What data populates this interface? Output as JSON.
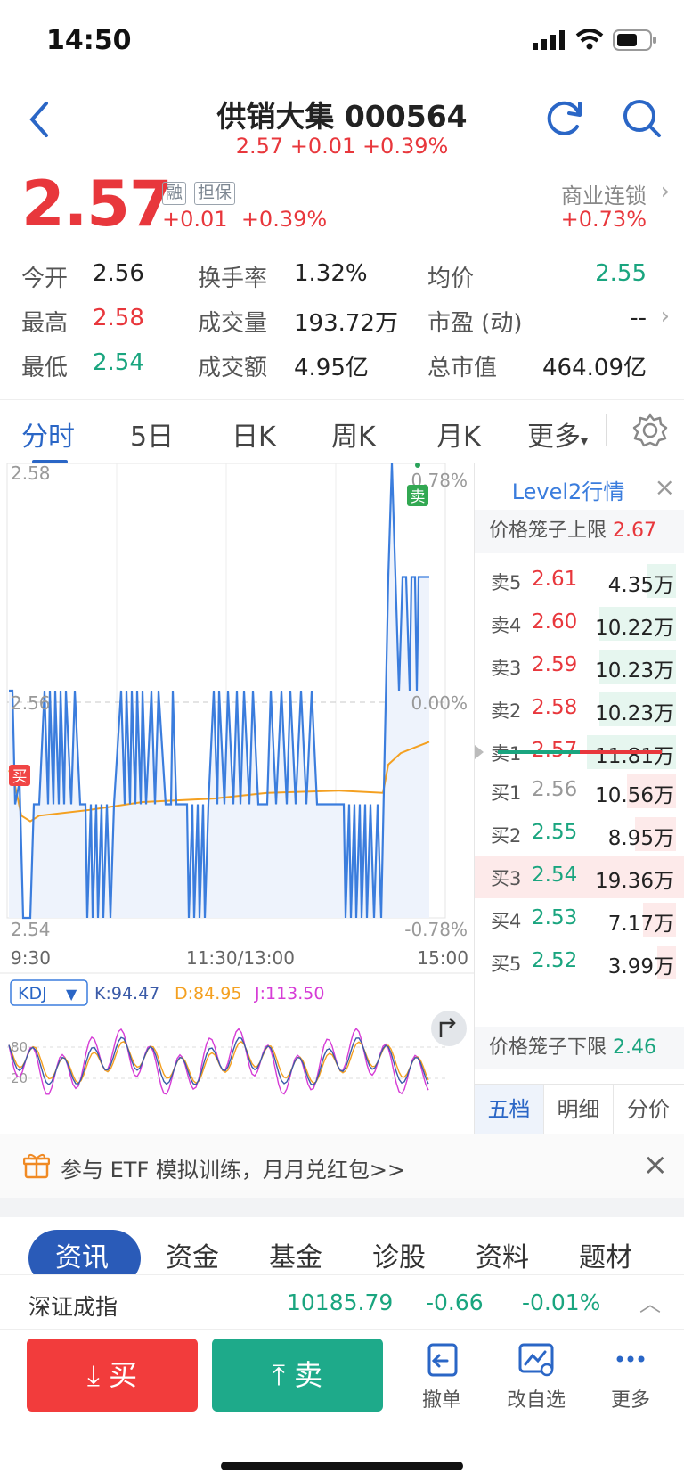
{
  "status_bar": {
    "time": "14:50"
  },
  "header": {
    "title": "供销大集 000564",
    "subtitle": "2.57 +0.01 +0.39%"
  },
  "quote": {
    "price": "2.57",
    "tag_margin": "融",
    "tag_guarantee": "担保",
    "change": "+0.01",
    "change_pct": "+0.39%",
    "industry": "商业连锁",
    "industry_pct": "+0.73%"
  },
  "stats": [
    {
      "label": "今开",
      "value": "2.56",
      "color": "#222222"
    },
    {
      "label": "换手率",
      "value": "1.32%",
      "color": "#222222"
    },
    {
      "label": "均价",
      "value": "2.55",
      "color": "#1aa57f"
    },
    {
      "label": "最高",
      "value": "2.58",
      "color": "#e8373c"
    },
    {
      "label": "成交量",
      "value": "193.72万",
      "color": "#222222"
    },
    {
      "label": "市盈 (动)",
      "value": "--",
      "color": "#222222"
    },
    {
      "label": "最低",
      "value": "2.54",
      "color": "#1aa57f"
    },
    {
      "label": "成交额",
      "value": "4.95亿",
      "color": "#222222"
    },
    {
      "label": "总市值",
      "value": "464.09亿",
      "color": "#222222"
    }
  ],
  "tabs": [
    "分时",
    "5日",
    "日K",
    "周K",
    "月K",
    "更多"
  ],
  "chart": {
    "price_high": "2.58",
    "price_mid": "2.56",
    "price_low": "2.54",
    "pct_high": "0.78%",
    "pct_mid": "0.00%",
    "pct_low": "-0.78%",
    "time_start": "9:30",
    "time_mid": "11:30/13:00",
    "time_end": "15:00",
    "buy_marker": "买",
    "sell_marker": "卖",
    "kdj_label": "KDJ",
    "kdj_k": "K:94.47",
    "kdj_d": "D:84.95",
    "kdj_j": "J:113.50",
    "kdj_80": "80",
    "kdj_20": "20"
  },
  "chart_data": {
    "type": "line",
    "title": "",
    "xlabel": "",
    "ylabel": "",
    "ylim": [
      2.54,
      2.58
    ],
    "x_ticks": [
      "9:30",
      "11:30/13:00",
      "15:00"
    ],
    "series": [
      {
        "values": [
          2.56,
          2.55,
          2.54,
          2.55,
          2.56,
          2.55,
          2.56,
          2.55,
          2.54,
          2.55,
          2.56,
          2.55,
          2.56,
          2.55,
          2.54,
          2.55,
          2.56,
          2.55,
          2.56,
          2.55,
          2.54,
          2.55,
          2.57,
          2.58,
          2.57,
          2.56,
          2.57
        ]
      },
      {
        "values": [
          2.553,
          2.55,
          2.549,
          2.549,
          2.549,
          2.55,
          2.55,
          2.55,
          2.55,
          2.55,
          2.55,
          2.55,
          2.55,
          2.55,
          2.55,
          2.55,
          2.55,
          2.55,
          2.55,
          2.55,
          2.55,
          2.55,
          2.553,
          2.554,
          2.554,
          2.555,
          2.555
        ]
      }
    ],
    "indicator": {
      "name": "KDJ",
      "K": 94.47,
      "D": 84.95,
      "J": 113.5
    }
  },
  "level2": {
    "title": "Level2行情",
    "upper_limit_label": "价格笼子上限",
    "upper_limit": "2.67",
    "lower_limit_label": "价格笼子下限",
    "lower_limit": "2.46",
    "asks": [
      {
        "label": "卖5",
        "price": "2.61",
        "vol": "4.35万",
        "ratio": 0.33
      },
      {
        "label": "卖4",
        "price": "2.60",
        "vol": "10.22万",
        "ratio": 0.86
      },
      {
        "label": "卖3",
        "price": "2.59",
        "vol": "10.23万",
        "ratio": 0.86
      },
      {
        "label": "卖2",
        "price": "2.58",
        "vol": "10.23万",
        "ratio": 0.86
      },
      {
        "label": "卖1",
        "price": "2.57",
        "vol": "11.81万",
        "ratio": 1.0
      }
    ],
    "bids": [
      {
        "label": "买1",
        "price": "2.56",
        "vol": "10.56万",
        "ratio": 0.55,
        "price_color": "#999999"
      },
      {
        "label": "买2",
        "price": "2.55",
        "vol": "8.95万",
        "ratio": 0.46,
        "price_color": "#1aa57f"
      },
      {
        "label": "买3",
        "price": "2.54",
        "vol": "19.36万",
        "ratio": 1.0,
        "price_color": "#1aa57f"
      },
      {
        "label": "买4",
        "price": "2.53",
        "vol": "7.17万",
        "ratio": 0.37,
        "price_color": "#1aa57f"
      },
      {
        "label": "买5",
        "price": "2.52",
        "vol": "3.99万",
        "ratio": 0.21,
        "price_color": "#1aa57f"
      }
    ],
    "tabs": [
      "五档",
      "明细",
      "分价"
    ]
  },
  "promo": {
    "text": "参与 ETF 模拟训练，月月兑红包>>"
  },
  "news_tabs": [
    "资讯",
    "资金",
    "基金",
    "诊股",
    "资料",
    "题材"
  ],
  "index": {
    "name": "深证成指",
    "value": "10185.79",
    "change": "-0.66",
    "pct": "-0.01%"
  },
  "bottom": {
    "buy": "买",
    "sell": "卖",
    "cancel": "撤单",
    "watchlist": "改自选",
    "more": "更多"
  }
}
